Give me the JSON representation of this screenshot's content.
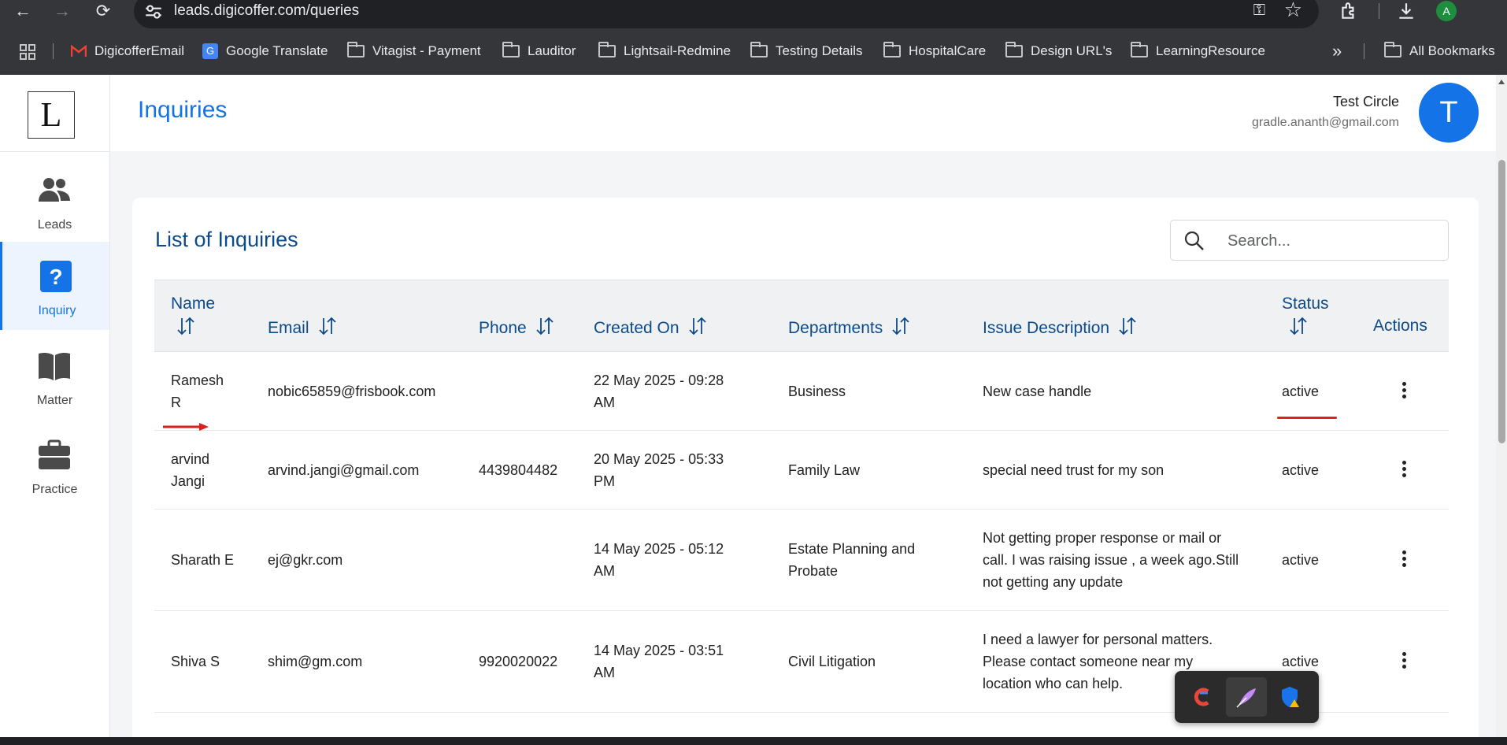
{
  "browser": {
    "url": "leads.digicoffer.com/queries",
    "profile_initial": "A",
    "bookmarks": [
      "DigicofferEmail",
      "Google Translate",
      "Vitagist - Payment",
      "Lauditor",
      "Lightsail-Redmine",
      "Testing Details",
      "HospitalCare",
      "Design URL's",
      "LearningResource"
    ],
    "more": "»",
    "all_bookmarks": "All Bookmarks"
  },
  "sidebar": {
    "logo": "L",
    "items": [
      {
        "label": "Leads",
        "icon": "users-icon",
        "active": false
      },
      {
        "label": "Inquiry",
        "icon": "question-icon",
        "active": true
      },
      {
        "label": "Matter",
        "icon": "book-icon",
        "active": false
      },
      {
        "label": "Practice",
        "icon": "briefcase-icon",
        "active": false
      }
    ]
  },
  "header": {
    "title": "Inquiries",
    "user_name": "Test Circle",
    "user_email": "gradle.ananth@gmail.com",
    "avatar_initial": "T"
  },
  "main": {
    "title": "List of Inquiries",
    "search_placeholder": "Search...",
    "columns": [
      "Name",
      "Email",
      "Phone",
      "Created On",
      "Departments",
      "Issue Description",
      "Status",
      "Actions"
    ],
    "rows": [
      {
        "name": [
          "Ramesh",
          "R"
        ],
        "email": "nobic65859@frisbook.com",
        "phone": "",
        "created": [
          "22 May 2025 - 09:28",
          "AM"
        ],
        "department": [
          "Business"
        ],
        "issue": [
          "New case handle"
        ],
        "status": "active"
      },
      {
        "name": [
          "arvind",
          "Jangi"
        ],
        "email": "arvind.jangi@gmail.com",
        "phone": "4439804482",
        "created": [
          "20 May 2025 - 05:33",
          "PM"
        ],
        "department": [
          "Family Law"
        ],
        "issue": [
          "special need trust for my son"
        ],
        "status": "active"
      },
      {
        "name": [
          "Sharath E"
        ],
        "email": "ej@gkr.com",
        "phone": "",
        "created": [
          "14 May 2025 - 05:12",
          "AM"
        ],
        "department": [
          "Estate Planning and",
          "Probate"
        ],
        "issue": [
          "Not getting proper response or mail or",
          "call. I was raising issue , a week ago.Still",
          "not getting any update"
        ],
        "status": "active"
      },
      {
        "name": [
          "Shiva S"
        ],
        "email": "shim@gm.com",
        "phone": "9920020022",
        "created": [
          "14 May 2025 - 03:51",
          "AM"
        ],
        "department": [
          "Civil Litigation"
        ],
        "issue": [
          "I need a lawyer for personal matters.",
          "Please contact someone near my",
          "location who can help."
        ],
        "status": "active"
      }
    ]
  },
  "colors": {
    "primary": "#1473e6",
    "heading": "#0d4a8a",
    "annotation": "#e01e1e"
  }
}
